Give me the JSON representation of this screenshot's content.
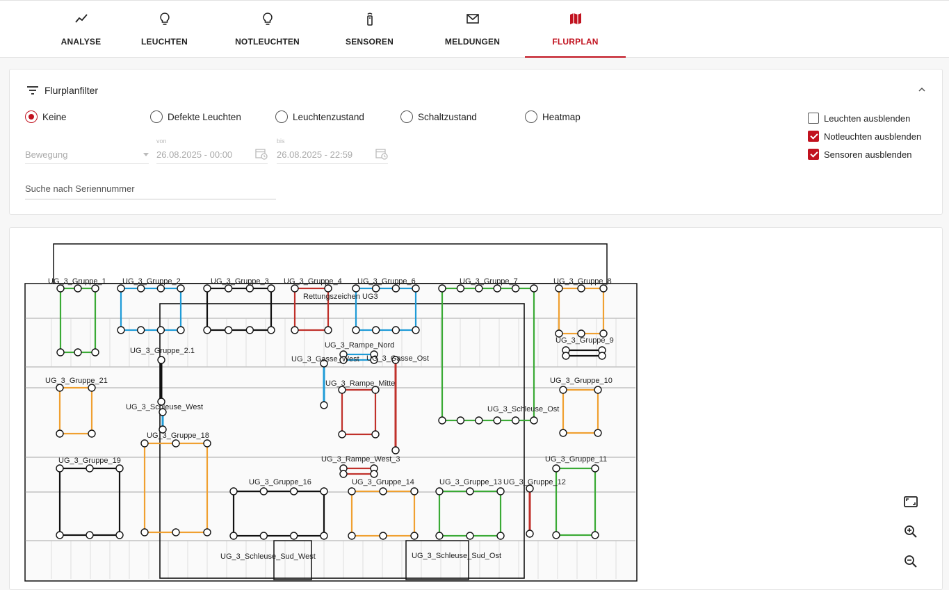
{
  "tabs": [
    {
      "label": "ANALYSE",
      "icon": "trend-icon"
    },
    {
      "label": "LEUCHTEN",
      "icon": "bulb-icon"
    },
    {
      "label": "NOTLEUCHTEN",
      "icon": "bulb-icon"
    },
    {
      "label": "SENSOREN",
      "icon": "sensor-icon"
    },
    {
      "label": "MELDUNGEN",
      "icon": "mail-icon"
    },
    {
      "label": "FLURPLAN",
      "icon": "map-icon",
      "active": true
    }
  ],
  "filter": {
    "title": "Flurplanfilter",
    "radios": [
      {
        "label": "Keine",
        "checked": true
      },
      {
        "label": "Defekte Leuchten",
        "checked": false
      },
      {
        "label": "Leuchtenzustand",
        "checked": false
      },
      {
        "label": "Schaltzustand",
        "checked": false
      },
      {
        "label": "Heatmap",
        "checked": false
      }
    ],
    "checkboxes": [
      {
        "label": "Leuchten ausblenden",
        "checked": false
      },
      {
        "label": "Notleuchten ausblenden",
        "checked": true
      },
      {
        "label": "Sensoren ausblenden",
        "checked": true
      }
    ],
    "select_value": "Bewegung",
    "from_label": "von",
    "from_value": "26.08.2025 - 00:00",
    "to_label": "bis",
    "to_value": "26.08.2025 - 22:59",
    "search_placeholder": "Suche nach Seriennummer"
  },
  "colors": {
    "accent": "#c1121f",
    "blue": "#1e9bd7",
    "green": "#3aaa35",
    "orange": "#f0a030",
    "red": "#c0302a",
    "black": "#111111"
  },
  "floorplan": {
    "groups": [
      {
        "label": "UG_3_Gruppe_1",
        "color": "green"
      },
      {
        "label": "UG_3_Gruppe_2",
        "color": "blue"
      },
      {
        "label": "UG_3_Gruppe_3",
        "color": "black"
      },
      {
        "label": "UG_3_Gruppe_4",
        "color": "red"
      },
      {
        "label": "UG_3_Gruppe_6",
        "color": "blue"
      },
      {
        "label": "UG_3_Gruppe_7",
        "color": "green"
      },
      {
        "label": "UG_3_Gruppe_8",
        "color": "orange"
      },
      {
        "label": "Rettungszeichen UG3",
        "color": "black"
      },
      {
        "label": "UG_3_Gruppe_9",
        "color": "black"
      },
      {
        "label": "UG_3_Rampe_Nord",
        "color": "blue"
      },
      {
        "label": "UG_3_Gruppe_2.1",
        "color": "black"
      },
      {
        "label": "UG_3_Gasse_West",
        "color": "blue"
      },
      {
        "label": "UG_3_Gasse_Ost",
        "color": "red"
      },
      {
        "label": "UG_3_Gruppe_21",
        "color": "orange"
      },
      {
        "label": "UG_3_Rampe_Mitte",
        "color": "red"
      },
      {
        "label": "UG_3_Gruppe_10",
        "color": "orange"
      },
      {
        "label": "UG_3_Schleuse_West",
        "color": "blue"
      },
      {
        "label": "UG_3_Schleuse_Ost",
        "color": "orange"
      },
      {
        "label": "UG_3_Gruppe_18",
        "color": "black"
      },
      {
        "label": "UG_3_Gruppe_19",
        "color": "red"
      },
      {
        "label": "UG_3_Rampe_West_3",
        "color": "green"
      },
      {
        "label": "UG_3_Gruppe_11",
        "color": "black"
      },
      {
        "label": "UG_3_Gruppe_16",
        "color": "orange"
      },
      {
        "label": "UG_3_Gruppe_14",
        "color": "green"
      },
      {
        "label": "UG_3_Gruppe_13",
        "color": "blue"
      },
      {
        "label": "UG_3_Gruppe_12",
        "color": "red"
      },
      {
        "label": "UG_3_Schleuse_Sud_West",
        "color": "red"
      },
      {
        "label": "UG_3_Schleuse_Sud_Ost",
        "color": "black"
      }
    ]
  },
  "zoom": {
    "fit": "fit-screen-icon",
    "in": "zoom-in-icon",
    "out": "zoom-out-icon"
  }
}
